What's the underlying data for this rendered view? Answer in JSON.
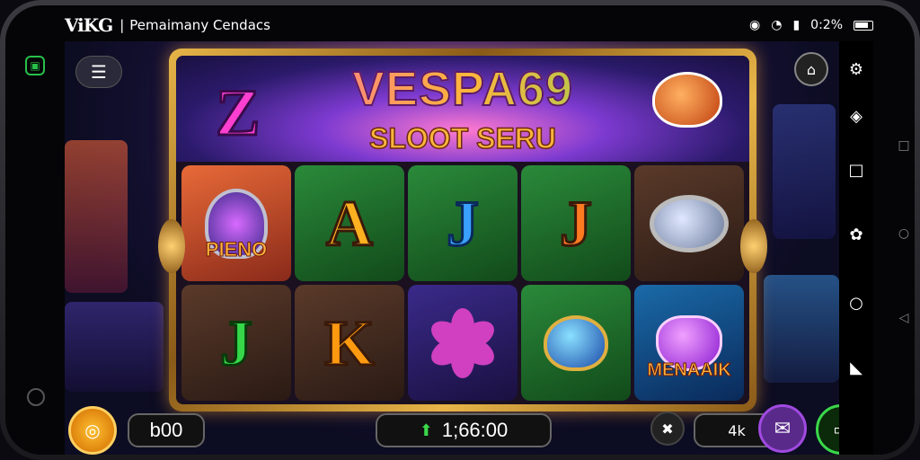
{
  "status": {
    "brand": "ViKG",
    "app_title": "Pemaimany Cendacs",
    "time": "0:2%"
  },
  "game": {
    "logo": "VESPA69",
    "subtitle": "SLOOT SERU",
    "big_letter": "Z",
    "reels": [
      {
        "kind": "badge",
        "label": "PIENO",
        "bg": "c-red"
      },
      {
        "kind": "letter",
        "label": "A",
        "bg": "c-green",
        "cls": "l-a"
      },
      {
        "kind": "letter",
        "label": "J",
        "bg": "c-green",
        "cls": "l-j1"
      },
      {
        "kind": "letter",
        "label": "J",
        "bg": "c-green",
        "cls": "l-j2"
      },
      {
        "kind": "mirror",
        "label": "",
        "bg": "c-dark"
      },
      {
        "kind": "letter",
        "label": "J",
        "bg": "c-dark",
        "cls": "l-j3"
      },
      {
        "kind": "letter",
        "label": "K",
        "bg": "c-dark",
        "cls": "l-k"
      },
      {
        "kind": "flower",
        "label": "",
        "bg": "c-purple"
      },
      {
        "kind": "gem",
        "label": "",
        "bg": "c-green"
      },
      {
        "kind": "heart",
        "label": "MENAAIK",
        "bg": "c-blue"
      }
    ],
    "balance": "b00",
    "win_amount": "1;66:00",
    "speed_label": "4k"
  },
  "icons": {
    "menu": "menu-icon",
    "home": "home-icon",
    "coin": "coin-icon",
    "close": "close-icon",
    "mail": "mail-icon",
    "box": "box-icon"
  },
  "colors": {
    "frame_gold": "#e7b548",
    "accent_green": "#3ad84a",
    "accent_purple": "#a04ae0"
  }
}
